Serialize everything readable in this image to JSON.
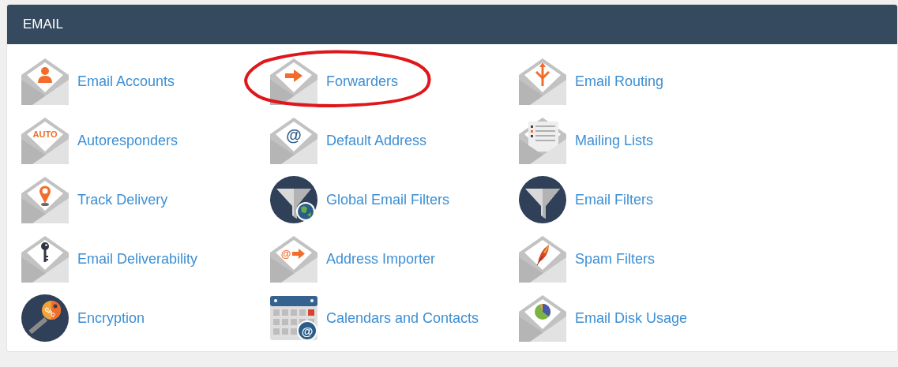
{
  "panel": {
    "title": "EMAIL",
    "items": [
      {
        "label": "Email Accounts",
        "highlighted": false
      },
      {
        "label": "Forwarders",
        "highlighted": true
      },
      {
        "label": "Email Routing",
        "highlighted": false
      },
      {
        "label": "Autoresponders",
        "highlighted": false,
        "icon_text": "AUTO"
      },
      {
        "label": "Default Address",
        "highlighted": false,
        "icon_text": "@"
      },
      {
        "label": "Mailing Lists",
        "highlighted": false
      },
      {
        "label": "Track Delivery",
        "highlighted": false
      },
      {
        "label": "Global Email Filters",
        "highlighted": false
      },
      {
        "label": "Email Filters",
        "highlighted": false
      },
      {
        "label": "Email Deliverability",
        "highlighted": false
      },
      {
        "label": "Address Importer",
        "highlighted": false,
        "icon_text": "@"
      },
      {
        "label": "Spam Filters",
        "highlighted": false
      },
      {
        "label": "Encryption",
        "highlighted": false,
        "icon_text": "GPG"
      },
      {
        "label": "Calendars and Contacts",
        "highlighted": false,
        "icon_text": "@"
      },
      {
        "label": "Email Disk Usage",
        "highlighted": false
      }
    ]
  }
}
